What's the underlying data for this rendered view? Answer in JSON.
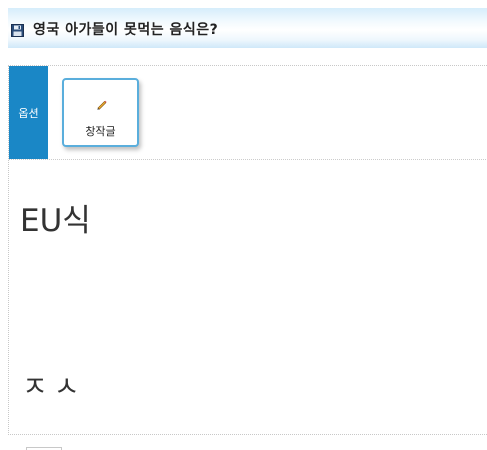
{
  "header": {
    "title": "영국 아가들이 못먹는 음식은?",
    "icon": "save-icon"
  },
  "toolbar": {
    "options_label": "옵션",
    "write_button_label": "창작글",
    "write_button_icon": "pencil-icon",
    "accent_color": "#1a87c6",
    "button_border_color": "#5aaedc"
  },
  "content": {
    "line1": "EU식",
    "line2": "ㅈㅅ"
  }
}
